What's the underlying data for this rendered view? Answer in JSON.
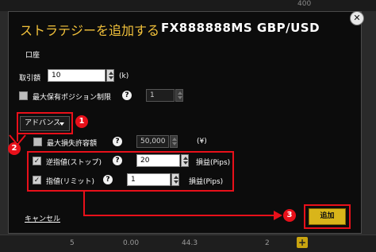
{
  "background": {
    "top_value": "400",
    "bottom_row": {
      "col1": "5",
      "col2": "0.00",
      "col3": "44.3",
      "col4": "2"
    }
  },
  "dialog": {
    "title_jp": "ストラテジーを追加する",
    "title_symbol": "FX888888MS  GBP/USD",
    "account_label": "口座",
    "lot": {
      "label": "取引額",
      "value": "10",
      "unit": "(k)"
    },
    "max_positions": {
      "label": "最大保有ポジション制限",
      "value": "1",
      "checked": false
    },
    "advanced_button": "アドバンス",
    "max_loss": {
      "label": "最大損失許容額",
      "value": "50,000",
      "unit": "(¥)",
      "checked": false
    },
    "stop": {
      "label": "逆指値(ストップ)",
      "value": "20",
      "unit": "損益(Pips)",
      "checked": true
    },
    "limit": {
      "label": "指値(リミット)",
      "value": "1",
      "unit": "損益(Pips)",
      "checked": true
    },
    "cancel_label": "キャンセル",
    "add_label": "追加"
  },
  "annotations": {
    "one": "1",
    "two": "2",
    "three": "3"
  },
  "colors": {
    "accent_red": "#e8101a",
    "title_gold": "#f3c23b",
    "add_button": "#d9b51a"
  }
}
